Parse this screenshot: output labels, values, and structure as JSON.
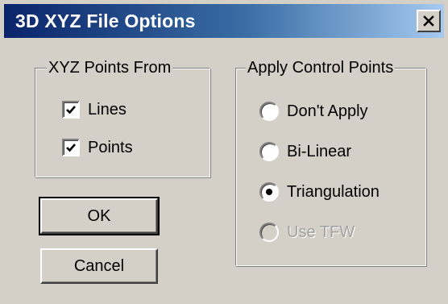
{
  "window": {
    "title": "3D XYZ File Options",
    "close_glyph": "✕"
  },
  "xyz_group": {
    "title": "XYZ Points From",
    "options": [
      {
        "label": "Lines",
        "checked": true
      },
      {
        "label": "Points",
        "checked": true
      }
    ]
  },
  "control_group": {
    "title": "Apply Control Points",
    "options": [
      {
        "label": "Don't Apply",
        "selected": false,
        "enabled": true
      },
      {
        "label": "Bi-Linear",
        "selected": false,
        "enabled": true
      },
      {
        "label": "Triangulation",
        "selected": true,
        "enabled": true
      },
      {
        "label": "Use TFW",
        "selected": false,
        "enabled": false
      }
    ]
  },
  "buttons": {
    "ok_label": "OK",
    "cancel_label": "Cancel"
  },
  "colors": {
    "dialog_face": "#d4d0c8",
    "titlebar_start": "#0a246a",
    "titlebar_end": "#a6caf0",
    "disabled_text": "#a0a0a0"
  },
  "icons": {
    "close": "close-icon",
    "check": "checkmark-icon",
    "radio_dot": "radio-dot-icon"
  }
}
